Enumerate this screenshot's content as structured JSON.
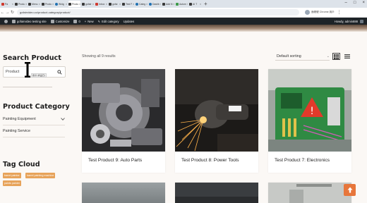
{
  "browser": {
    "tabs": [
      {
        "label": "Pa",
        "active": false,
        "icon": "red"
      },
      {
        "label": "Produ",
        "active": false,
        "icon": "dark"
      },
      {
        "label": "Menu",
        "active": false,
        "icon": "dark"
      },
      {
        "label": "Produ",
        "active": false,
        "icon": "dark"
      },
      {
        "label": "Widg",
        "active": false,
        "icon": "wp"
      },
      {
        "label": "Produ",
        "active": true,
        "icon": "dark"
      },
      {
        "label": "gofair",
        "active": false,
        "icon": "dark"
      },
      {
        "label": "Inbox",
        "active": false,
        "icon": "red"
      },
      {
        "label": "gofai",
        "active": false,
        "icon": "dark"
      },
      {
        "label": "Test F",
        "active": false,
        "icon": "dark"
      },
      {
        "label": "Categ",
        "active": false,
        "icon": "wp"
      },
      {
        "label": "Dashb",
        "active": false,
        "icon": "wp"
      },
      {
        "label": "Add N",
        "active": false,
        "icon": "dark"
      },
      {
        "label": "Autom",
        "active": false,
        "icon": "green"
      },
      {
        "label": "AI T",
        "active": false,
        "icon": "dark"
      }
    ],
    "url": "gofairvideo.co/product-category/product/",
    "profile_label": "面帳號 Chrome 用戶"
  },
  "admin_bar": {
    "site_name": "gofairvideo testing site",
    "customize": "Customize",
    "comments": "0",
    "new": "New",
    "edit_category": "Edit category",
    "updates": "Updates",
    "howdy": "Howdy, admin888"
  },
  "sidebar": {
    "search_title": "Search Product",
    "search_value": "Product",
    "search_tooltip": "搜尋 (商品已)",
    "category_title": "Product Category",
    "categories": [
      "Painting Equipment",
      "Painting Service"
    ],
    "tag_title": "Tag Cloud",
    "tags": [
      "barrel painter",
      "barrel painting machine",
      "paints painter"
    ]
  },
  "shop": {
    "result_count": "Showing all 9 results",
    "sort_selected": "Default sorting",
    "products": [
      {
        "title": "Test Product 9: Auto Parts"
      },
      {
        "title": "Test Product 8: Power Tools"
      },
      {
        "title": "Test Product 7: Electronics"
      }
    ]
  },
  "colors": {
    "accent": "#e7763b",
    "tag": "#e7a35a",
    "admin_bar": "#1d2327",
    "page_bg": "#fbf8f5"
  },
  "icons": {
    "search": "search-icon",
    "grid": "grid-view-icon",
    "list": "list-view-icon",
    "scroll_top": "arrow-up-icon",
    "text_cursor": "text-cursor-icon"
  }
}
